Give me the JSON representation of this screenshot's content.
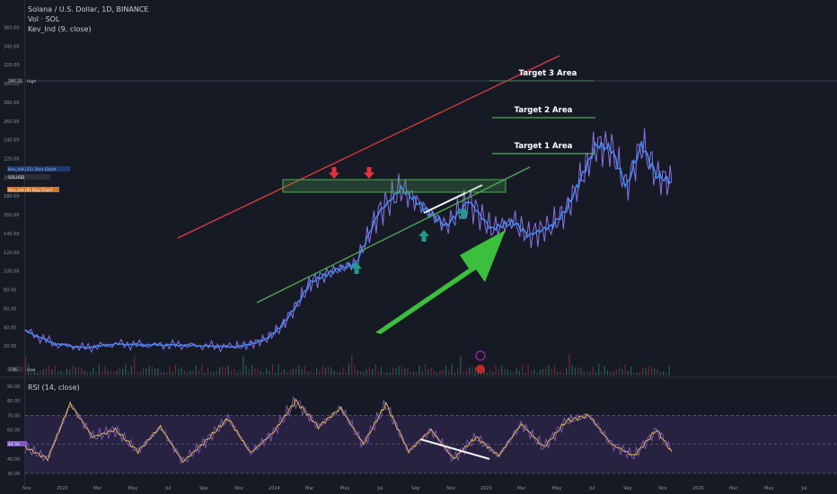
{
  "header": {
    "title": "Solana / U.S. Dollar, 1D, BINANCE",
    "vol": "Vol · SOL",
    "indicator": "Kev_Ind  (9, close)"
  },
  "rsi_panel": {
    "title": "RSI (14, close)"
  },
  "price_badges": {
    "high_value": "295.31",
    "high_label": "High",
    "low_value": "7.06",
    "low_label": "Low",
    "ind_21": "Kev_Ind (21) 3hrs Chart",
    "ind_sol": "SOLUSD",
    "ind_9": "Kev_Ind (9) Day Chart"
  },
  "rsi_badge": "44.56",
  "annotations": {
    "target1": "Target 1 Area",
    "target2": "Target 2 Area",
    "target3": "Target 3 Area"
  },
  "colors": {
    "background": "#161a25",
    "price_line": "#8e6fe6",
    "ma_line": "#2f8ff2",
    "resistance": "#e23a3a",
    "support": "#4caf50",
    "target_line": "#4caf50",
    "big_arrow": "#3cbf3c",
    "down_arrow": "#e5303c",
    "up_arrow": "#1e9b8a",
    "rsi_line": "#7e57c2",
    "rsi_ma": "#e6b94d",
    "rsi_band": "#2a2545"
  },
  "chart_data": [
    {
      "type": "line",
      "title": "Solana / U.S. Dollar, 1D, BINANCE",
      "y_ticks": [
        20,
        40,
        60,
        80,
        100,
        120,
        140,
        160,
        180,
        200,
        220,
        240,
        260,
        280,
        300,
        320,
        340,
        360
      ],
      "x_ticks": [
        "Nov",
        "2023",
        "Mar",
        "May",
        "Jul",
        "Sep",
        "Nov",
        "2024",
        "Mar",
        "May",
        "Jul",
        "Sep",
        "Nov",
        "2025",
        "Mar",
        "May",
        "Jul",
        "Sep",
        "Nov",
        "2026",
        "Mar",
        "May",
        "Jul"
      ],
      "ylim": [
        0,
        370
      ],
      "grid": false,
      "series": [
        {
          "name": "Kev_Ind",
          "x": [
            0,
            4,
            8,
            12,
            16,
            20,
            24,
            28,
            30,
            32,
            34,
            36,
            38,
            41,
            44,
            47,
            50,
            53,
            56,
            59,
            62,
            65,
            67,
            70,
            72,
            74,
            76,
            78,
            80,
            82,
            84,
            86
          ],
          "values": [
            36,
            22,
            18,
            22,
            21,
            21,
            20,
            19,
            22,
            27,
            40,
            62,
            88,
            100,
            108,
            162,
            188,
            168,
            148,
            175,
            145,
            152,
            138,
            148,
            165,
            200,
            235,
            230,
            190,
            235,
            202,
            195
          ]
        }
      ]
    },
    {
      "type": "line",
      "title": "RSI (14, close)",
      "y_ticks": [
        30,
        40,
        50,
        60,
        70,
        80,
        90
      ],
      "ylim": [
        25,
        95
      ],
      "bands": [
        30,
        50,
        70
      ],
      "series": [
        {
          "name": "RSI",
          "x": [
            0,
            3,
            6,
            9,
            12,
            15,
            18,
            21,
            24,
            27,
            30,
            33,
            36,
            39,
            42,
            45,
            48,
            51,
            54,
            57,
            60,
            63,
            66,
            69,
            72,
            75,
            78,
            81,
            84,
            86
          ],
          "values": [
            48,
            40,
            78,
            55,
            60,
            45,
            62,
            38,
            52,
            68,
            44,
            58,
            80,
            62,
            75,
            50,
            78,
            45,
            60,
            40,
            55,
            42,
            64,
            48,
            66,
            70,
            50,
            42,
            60,
            45
          ]
        }
      ]
    }
  ]
}
